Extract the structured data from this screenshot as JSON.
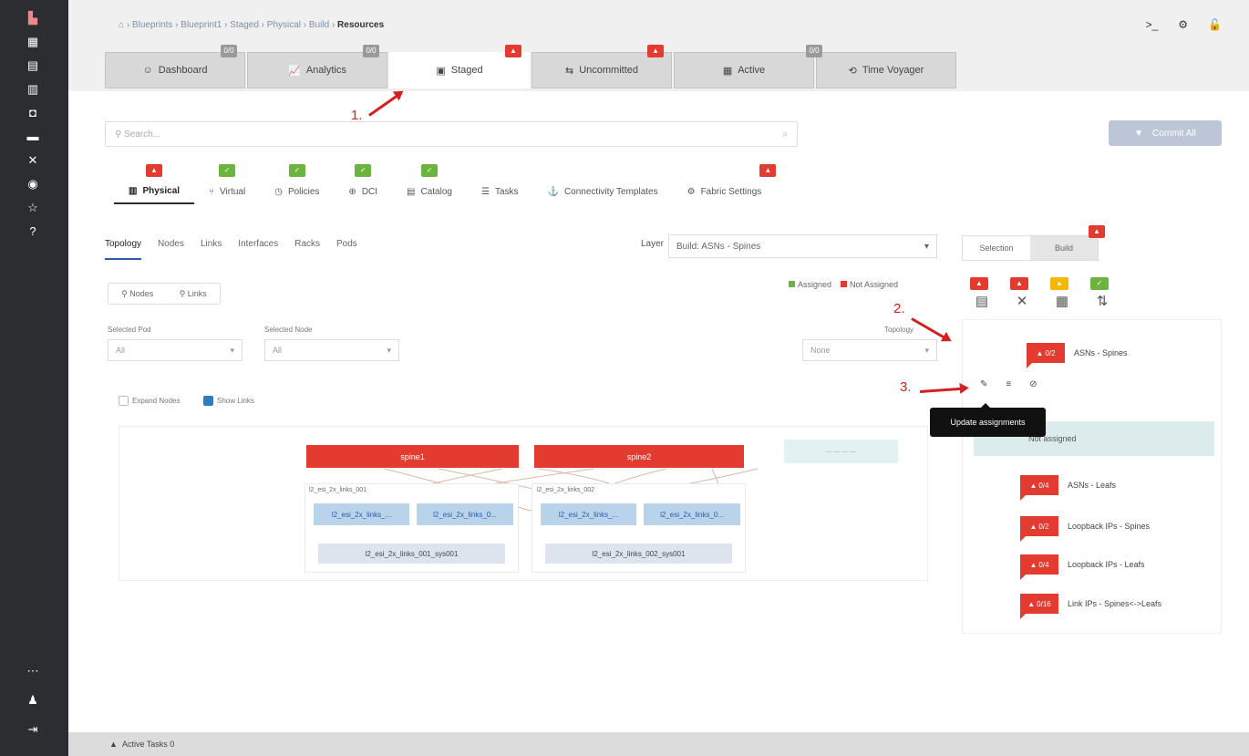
{
  "sidebar": {
    "icons": [
      "apstra-logo-icon",
      "blueprints-icon",
      "design-icon",
      "resources-icon",
      "external-systems-icon",
      "devices-icon",
      "tools-icon",
      "database-icon",
      "favorites-icon",
      "help-icon"
    ],
    "bottom_icons": [
      "more-icon",
      "user-icon",
      "logout-icon"
    ]
  },
  "header": {
    "breadcrumb": {
      "home": "⌂",
      "path": "› Blueprints › Blueprint1 › Staged › Physical › Build ›",
      "current": "Resources"
    },
    "right": {
      "cli": ">_",
      "gear": "⚙",
      "lock": "🔓"
    },
    "tabs": [
      {
        "label": "Dashboard",
        "icon": "☺",
        "badge": "0/0"
      },
      {
        "label": "Analytics",
        "icon": "📈",
        "badge": "0/0"
      },
      {
        "label": "Staged",
        "icon": "▣",
        "badge": "▲"
      },
      {
        "label": "Uncommitted",
        "icon": "⇆",
        "badge": "▲"
      },
      {
        "label": "Active",
        "icon": "▦",
        "badge": ""
      },
      {
        "label": "Time Voyager",
        "icon": "⟲",
        "badge": "0/0"
      }
    ]
  },
  "search": {
    "icon": "⚲",
    "placeholder": "Search...",
    "mag": "⌕"
  },
  "primary_button": {
    "icon": "▼",
    "label": "Commit All"
  },
  "subtabs": [
    {
      "label": "Physical",
      "icon": "▥"
    },
    {
      "label": "Virtual",
      "icon": "⑂"
    },
    {
      "label": "Policies",
      "icon": "◷"
    },
    {
      "label": "DCI",
      "icon": "⊕"
    },
    {
      "label": "Catalog",
      "icon": "▤"
    },
    {
      "label": "Tasks",
      "icon": "☰"
    },
    {
      "label": "Connectivity Templates",
      "icon": "⚓"
    },
    {
      "label": "Fabric Settings",
      "icon": "⚙"
    }
  ],
  "inner_tabs": [
    "Topology",
    "Nodes",
    "Links",
    "Interfaces",
    "Racks",
    "Pods"
  ],
  "layer": {
    "label": "Layer",
    "value": "Build: ASNs - Spines",
    "caret": "▾"
  },
  "legend": {
    "assigned": "Assigned",
    "not_assigned": "Not Assigned"
  },
  "search_buttons": {
    "nodes": "Nodes",
    "links": "Links"
  },
  "filters": {
    "selected_pod_label": "Selected Pod",
    "selected_pod_value": "All",
    "selected_node_label": "Selected Node",
    "selected_node_value": "All",
    "topology_label": "Topology",
    "topology_value": "None",
    "caret": "▾"
  },
  "checkboxes": {
    "expand_nodes": "Expand Nodes",
    "show_links": "Show Links"
  },
  "topology": {
    "spines": [
      "spine1",
      "spine2"
    ],
    "rack_labels": [
      "l2_esi_2x_links_001",
      "l2_esi_2x_links_002"
    ],
    "leaves": [
      "l2_esi_2x_links_...",
      "l2_esi_2x_links_0...",
      "l2_esi_2x_links_...",
      "l2_esi_2x_links_0..."
    ],
    "systems": [
      "l2_esi_2x_links_001_sys001",
      "l2_esi_2x_links_002_sys001"
    ]
  },
  "right_panel": {
    "tabs": [
      "Selection",
      "Build"
    ],
    "icon_row": [
      {
        "name": "clipboard-icon",
        "glyph": "▤",
        "badge": "▲"
      },
      {
        "name": "fabric-icon",
        "glyph": "✕",
        "badge": "▲"
      },
      {
        "name": "server-icon",
        "glyph": "▦",
        "badge": "▲"
      },
      {
        "name": "links-icon",
        "glyph": "⇅",
        "badge": "✓"
      }
    ],
    "rows": [
      {
        "count": "0/2",
        "label": "ASNs - Spines"
      },
      {
        "count": "0/4",
        "label": "ASNs - Leafs"
      },
      {
        "count": "0/2",
        "label": "Loopback IPs - Spines"
      },
      {
        "count": "0/4",
        "label": "Loopback IPs - Leafs"
      },
      {
        "count": "0/16",
        "label": "Link IPs - Spines<->Leafs"
      }
    ],
    "row_icons": [
      "✎",
      "≡",
      "⊘"
    ],
    "tooltip": "Update assignments",
    "assigned_text": "Not assigned"
  },
  "annotations": [
    "1.",
    "2.",
    "3."
  ],
  "bottombar": {
    "caret": "▲",
    "label": "Active Tasks 0"
  },
  "colors": {
    "sidebar": "#2b2d31",
    "red": "#e33b2f",
    "green": "#6cb33f",
    "annotation": "#d42020"
  }
}
